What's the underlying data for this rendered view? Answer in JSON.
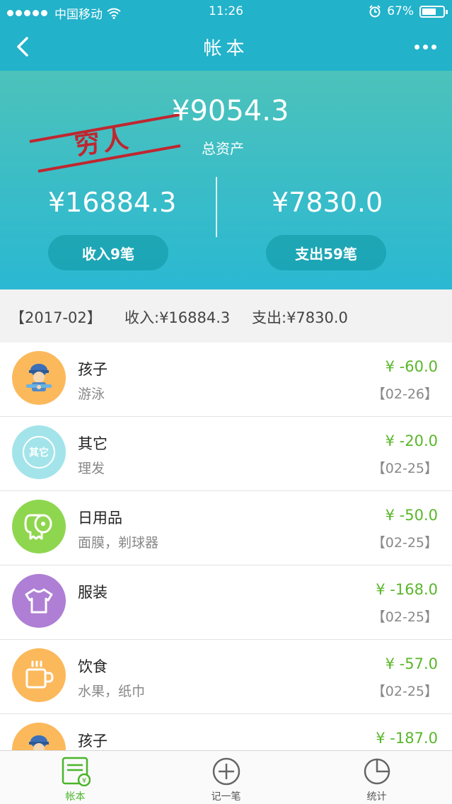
{
  "status_bar": {
    "carrier": "中国移动",
    "time": "11:26",
    "battery": "67%",
    "battery_level": 0.67
  },
  "header": {
    "title": "帐本"
  },
  "summary": {
    "total": "¥9054.3",
    "total_label": "总资产",
    "stamp_text": "穷人",
    "income_amount": "¥16884.3",
    "expense_amount": "¥7830.0",
    "income_button": "收入9笔",
    "expense_button": "支出59笔"
  },
  "month_bar": {
    "month": "【2017-02】",
    "income": "收入:¥16884.3",
    "expense": "支出:¥7830.0"
  },
  "records": [
    {
      "category": "孩子",
      "note": "游泳",
      "amount": "¥ -60.0",
      "date": "【02-26】",
      "color": "#fbb95c",
      "icon": "child-icon"
    },
    {
      "category": "其它",
      "note": "理发",
      "amount": "¥ -20.0",
      "date": "【02-25】",
      "color": "#a3e4ea",
      "icon": "other-icon",
      "icon_text": "其它"
    },
    {
      "category": "日用品",
      "note": "面膜，剃球器",
      "amount": "¥ -50.0",
      "date": "【02-25】",
      "color": "#8fd64f",
      "icon": "toilet-paper-icon"
    },
    {
      "category": "服装",
      "note": "",
      "amount": "¥ -168.0",
      "date": "【02-25】",
      "color": "#ae7fd4",
      "icon": "tshirt-icon"
    },
    {
      "category": "饮食",
      "note": "水果，纸巾",
      "amount": "¥ -57.0",
      "date": "【02-25】",
      "color": "#fbb95c",
      "icon": "cup-icon"
    },
    {
      "category": "孩子",
      "note": "",
      "amount": "¥ -187.0",
      "date": "",
      "color": "#fbb95c",
      "icon": "child-icon"
    }
  ],
  "tabs": [
    {
      "label": "帐本",
      "icon": "ledger-icon",
      "active": true
    },
    {
      "label": "记一笔",
      "icon": "add-icon",
      "active": false
    },
    {
      "label": "统计",
      "icon": "pie-chart-icon",
      "active": false
    }
  ],
  "colors": {
    "header": "#22b2ca",
    "income_green": "#5ab62a",
    "stamp_red": "#c0262f"
  }
}
